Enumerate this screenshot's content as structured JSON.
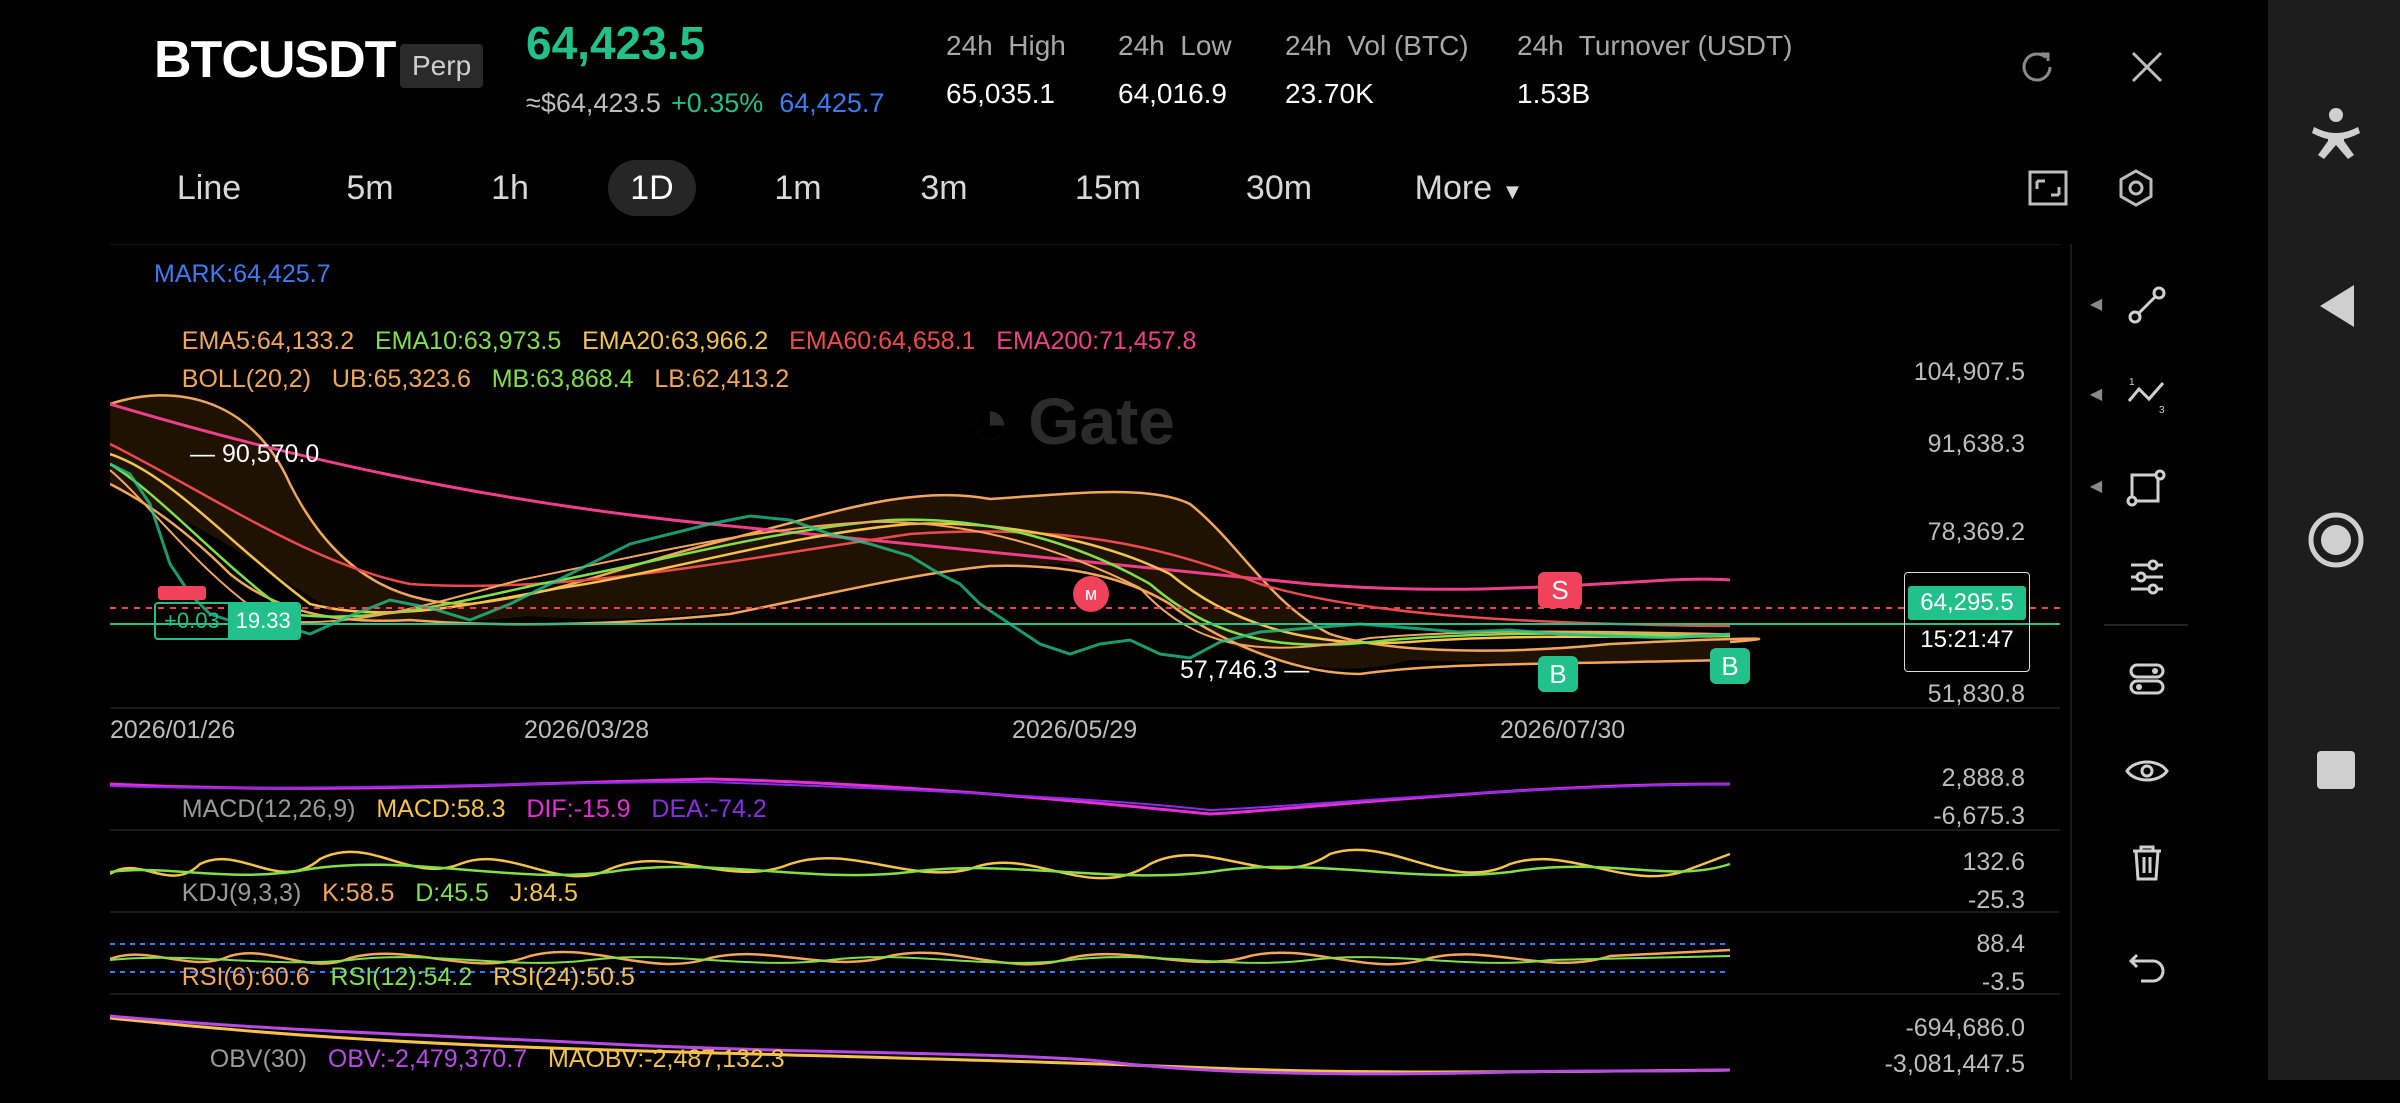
{
  "header": {
    "symbol": "BTCUSDT",
    "contract_type": "Perp",
    "last_price": "64,423.5",
    "usd_price": "≈$64,423.5",
    "change_pct": "+0.35%",
    "mark_price": "64,425.7",
    "stats": [
      {
        "label": "24h  High",
        "value": "65,035.1"
      },
      {
        "label": "24h  Low",
        "value": "64,016.9"
      },
      {
        "label": "24h  Vol (BTC)",
        "value": "23.70K"
      },
      {
        "label": "24h  Turnover (USDT)",
        "value": "1.53B"
      }
    ],
    "icons": [
      "refresh-icon",
      "close-icon"
    ]
  },
  "timeframes": {
    "items": [
      "Line",
      "5m",
      "1h",
      "1D",
      "1m",
      "3m",
      "15m",
      "30m"
    ],
    "selected": "1D",
    "more_label": "More"
  },
  "chart": {
    "watermark": "Gate",
    "indicators_line1": "MARK:64,425.7",
    "ema": [
      {
        "label": "EMA5:64,133.2",
        "color": "#f2a65a"
      },
      {
        "label": "EMA10:63,973.5",
        "color": "#7fe04a"
      },
      {
        "label": "EMA20:63,966.2",
        "color": "#f5c24a"
      },
      {
        "label": "EMA60:64,658.1",
        "color": "#ef4a4a"
      },
      {
        "label": "EMA200:71,457.8",
        "color": "#ef3f8a"
      }
    ],
    "boll": [
      {
        "label": "BOLL(20,2)",
        "color": "#f2a65a"
      },
      {
        "label": "UB:65,323.6",
        "color": "#f2a65a"
      },
      {
        "label": "MB:63,868.4",
        "color": "#7fe04a"
      },
      {
        "label": "LB:62,413.2",
        "color": "#f2a65a"
      }
    ],
    "price_axis": [
      "104,907.5",
      "91,638.3",
      "78,369.2",
      "51,830.8"
    ],
    "date_axis": [
      "2026/01/26",
      "2026/03/28",
      "2026/05/29",
      "2026/07/30"
    ],
    "high_label": "90,570.0",
    "low_label": "57,746.3",
    "current_price_tag": "64,295.5",
    "countdown": "15:21:47",
    "position_pnl": "+0.03",
    "position_size": "19.33",
    "markers": {
      "sell": "S",
      "buy": "B"
    },
    "macd": {
      "label": "MACD(12,26,9)",
      "macd": "MACD:58.3",
      "dif": "DIF:-15.9",
      "dea": "DEA:-74.2",
      "axis": [
        "2,888.8",
        "-6,675.3"
      ]
    },
    "kdj": {
      "label": "KDJ(9,3,3)",
      "k": "K:58.5",
      "d": "D:45.5",
      "j": "J:84.5",
      "axis": [
        "132.6",
        "-25.3"
      ]
    },
    "rsi": {
      "r6": "RSI(6):60.6",
      "r12": "RSI(12):54.2",
      "r24": "RSI(24):50.5",
      "axis": [
        "88.4",
        "-3.5"
      ]
    },
    "obv": {
      "label": "OBV(30)",
      "obv": "OBV:-2,479,370.7",
      "maobv": "MAOBV:-2,487,132.3",
      "axis": [
        "-694,686.0",
        "-3,081,447.5"
      ]
    }
  },
  "colors": {
    "up": "#22c08a",
    "down": "#f0435b",
    "mark": "#3d7bf5",
    "accent": "#22c08a"
  },
  "right_toolbar": [
    "trend-line-icon",
    "fib-icon",
    "shape-icon",
    "settings-sliders-icon",
    "indicator-toggle-icon",
    "eye-icon",
    "trash-icon",
    "undo-icon"
  ],
  "system_nav": [
    "accessibility-icon",
    "back-icon",
    "home-icon",
    "recents-icon"
  ]
}
